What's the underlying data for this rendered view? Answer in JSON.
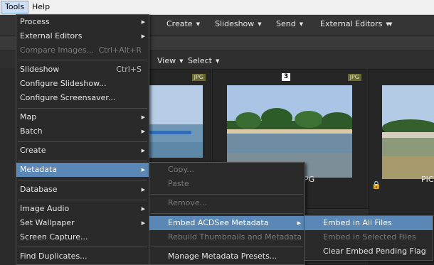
{
  "menubar": {
    "tools": "Tools",
    "help": "Help"
  },
  "toolbar": {
    "create": "Create",
    "slideshow": "Slideshow",
    "send": "Send",
    "external_editors": "External Editors"
  },
  "viewbar": {
    "view": "View",
    "select": "Select"
  },
  "tiles": [
    {
      "badge": "JPG"
    },
    {
      "badge": "JPG",
      "number": "3",
      "filename_suffix": "PG"
    },
    {
      "filename_prefix": "PICT"
    }
  ],
  "tools_menu": {
    "items": [
      {
        "label": "Process",
        "submenu": true
      },
      {
        "label": "External Editors",
        "submenu": true
      },
      {
        "label": "Compare Images...",
        "shortcut": "Ctrl+Alt+R",
        "disabled": true
      },
      {
        "label": "Slideshow",
        "shortcut": "Ctrl+S"
      },
      {
        "label": "Configure Slideshow..."
      },
      {
        "label": "Configure Screensaver..."
      },
      {
        "label": "Map",
        "submenu": true
      },
      {
        "label": "Batch",
        "submenu": true
      },
      {
        "label": "Create",
        "submenu": true
      },
      {
        "label": "Metadata",
        "submenu": true,
        "highlighted": true
      },
      {
        "label": "Database",
        "submenu": true
      },
      {
        "label": "Image Audio",
        "submenu": true
      },
      {
        "label": "Set Wallpaper",
        "submenu": true
      },
      {
        "label": "Screen Capture..."
      },
      {
        "label": "Find Duplicates..."
      }
    ]
  },
  "metadata_menu": {
    "items": [
      {
        "label": "Copy...",
        "disabled": true
      },
      {
        "label": "Paste",
        "disabled": true
      },
      {
        "label": "Remove...",
        "disabled": true
      },
      {
        "label": "Embed ACDSee Metadata",
        "submenu": true,
        "highlighted": true
      },
      {
        "label": "Rebuild Thumbnails and Metadata",
        "disabled": true
      },
      {
        "label": "Manage Metadata Presets..."
      }
    ]
  },
  "embed_menu": {
    "items": [
      {
        "label": "Embed in All Files",
        "highlighted": true
      },
      {
        "label": "Embed in Selected Files",
        "disabled": true
      },
      {
        "label": "Clear Embed Pending Flag"
      }
    ]
  },
  "colors": {
    "highlight": "#5a87b5",
    "menu_bg": "#2a2a2a",
    "disabled_text": "#7a7a7a"
  }
}
